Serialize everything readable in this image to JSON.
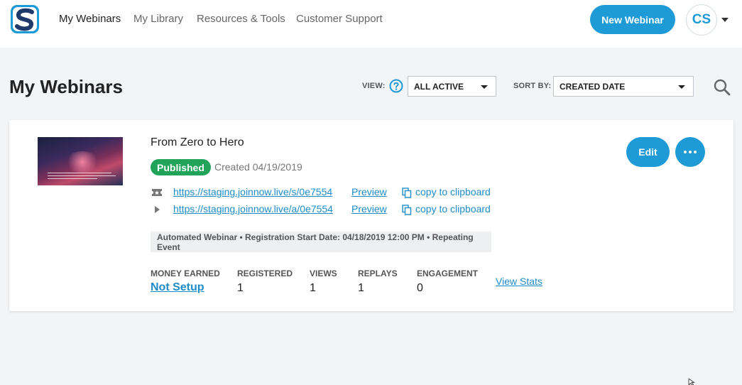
{
  "nav": {
    "logo_letter": "S",
    "items": [
      {
        "label": "My Webinars",
        "active": true
      },
      {
        "label": "My Library",
        "active": false
      },
      {
        "label": "Resources & Tools",
        "active": false
      },
      {
        "label": "Customer Support",
        "active": false
      }
    ],
    "new_webinar_label": "New Webinar",
    "avatar_initials": "CS"
  },
  "header": {
    "title": "My Webinars",
    "view_label": "VIEW:",
    "view_value": "ALL ACTIVE",
    "sort_label": "SORT BY:",
    "sort_value": "CREATED DATE"
  },
  "webinar": {
    "title": "From Zero to Hero",
    "status": "Published",
    "created": "Created 04/19/2019",
    "links": [
      {
        "icon": "ticket-icon",
        "url": "https://staging.joinnow.live/s/0e7554",
        "preview": "Preview",
        "copy": "copy to clipboard"
      },
      {
        "icon": "play-icon",
        "url": "https://staging.joinnow.live/a/0e7554",
        "preview": "Preview",
        "copy": "copy to clipboard"
      }
    ],
    "meta": "Automated Webinar • Registration Start Date: 04/18/2019 12:00 PM • Repeating Event",
    "stats": {
      "money_label": "MONEY EARNED",
      "money_value": "Not Setup",
      "registered_label": "REGISTERED",
      "registered_value": "1",
      "views_label": "VIEWS",
      "views_value": "1",
      "replays_label": "REPLAYS",
      "replays_value": "1",
      "engagement_label": "ENGAGEMENT",
      "engagement_value": "0",
      "view_stats": "View Stats"
    },
    "edit_label": "Edit"
  },
  "colors": {
    "accent": "#1e9ad6",
    "published": "#21a35a",
    "link": "#1e8cc7"
  }
}
